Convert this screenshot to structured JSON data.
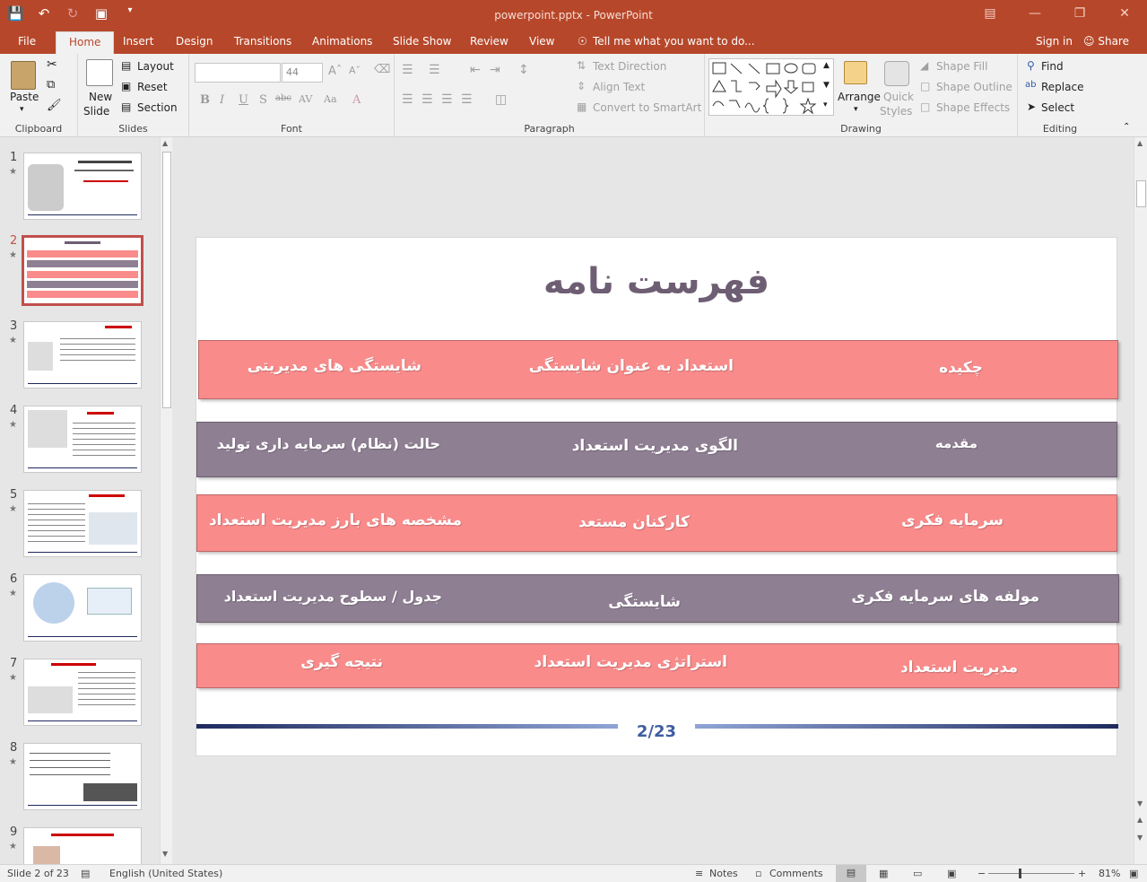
{
  "titlebar": {
    "doc_title": "powerpoint.pptx - PowerPoint"
  },
  "tabs": [
    {
      "label": "File"
    },
    {
      "label": "Home"
    },
    {
      "label": "Insert"
    },
    {
      "label": "Design"
    },
    {
      "label": "Transitions"
    },
    {
      "label": "Animations"
    },
    {
      "label": "Slide Show"
    },
    {
      "label": "Review"
    },
    {
      "label": "View"
    }
  ],
  "tell_me": "Tell me what you want to do...",
  "sign_in": "Sign in",
  "share": "Share",
  "ribbon": {
    "clipboard": {
      "paste": "Paste",
      "label": "Clipboard"
    },
    "slides": {
      "new_slide_1": "New",
      "new_slide_2": "Slide",
      "layout": "Layout",
      "reset": "Reset",
      "section": "Section",
      "label": "Slides"
    },
    "font": {
      "font_name": "",
      "font_size": "44",
      "label": "Font"
    },
    "paragraph": {
      "text_direction": "Text Direction",
      "align_text": "Align Text",
      "convert_smartart": "Convert to SmartArt",
      "label": "Paragraph"
    },
    "drawing": {
      "arrange": "Arrange",
      "quick_styles_1": "Quick",
      "quick_styles_2": "Styles",
      "shape_fill": "Shape Fill",
      "shape_outline": "Shape Outline",
      "shape_effects": "Shape Effects",
      "label": "Drawing"
    },
    "editing": {
      "find": "Find",
      "replace": "Replace",
      "select": "Select",
      "label": "Editing"
    }
  },
  "thumbnails": [
    {
      "num": "1"
    },
    {
      "num": "2"
    },
    {
      "num": "3"
    },
    {
      "num": "4"
    },
    {
      "num": "5"
    },
    {
      "num": "6"
    },
    {
      "num": "7"
    },
    {
      "num": "8"
    },
    {
      "num": "9"
    }
  ],
  "slide": {
    "title": "فهرست نامه",
    "rows": [
      {
        "style": "pink",
        "cells": [
          "چکیده",
          "استعداد به عنوان شایستگی",
          "شایستگی های مدیریتی"
        ]
      },
      {
        "style": "gray",
        "cells": [
          "مقدمه",
          "الگوی مدیریت استعداد",
          "حالت (نظام) سرمایه داری تولید"
        ]
      },
      {
        "style": "pink",
        "cells": [
          "سرمایه فکری",
          "کارکنان مستعد",
          "مشخصه های بارز مدیریت استعداد"
        ]
      },
      {
        "style": "gray",
        "cells": [
          "مولفه های سرمایه فکری",
          "شایستگی",
          "جدول / سطوح مدیریت استعداد"
        ]
      },
      {
        "style": "pink",
        "cells": [
          "مدیریت استعداد",
          "استراتژی مدیریت استعداد",
          "نتیجه گیری"
        ]
      }
    ],
    "page_number": "2/23"
  },
  "status": {
    "slide_info": "Slide 2 of 23",
    "language": "English (United States)",
    "notes": "Notes",
    "comments": "Comments",
    "zoom": "81%"
  },
  "colors": {
    "accent": "#b7472a",
    "row_pink": "#fa8b8b",
    "row_gray": "#8f7f93",
    "title": "#6e5e73"
  }
}
